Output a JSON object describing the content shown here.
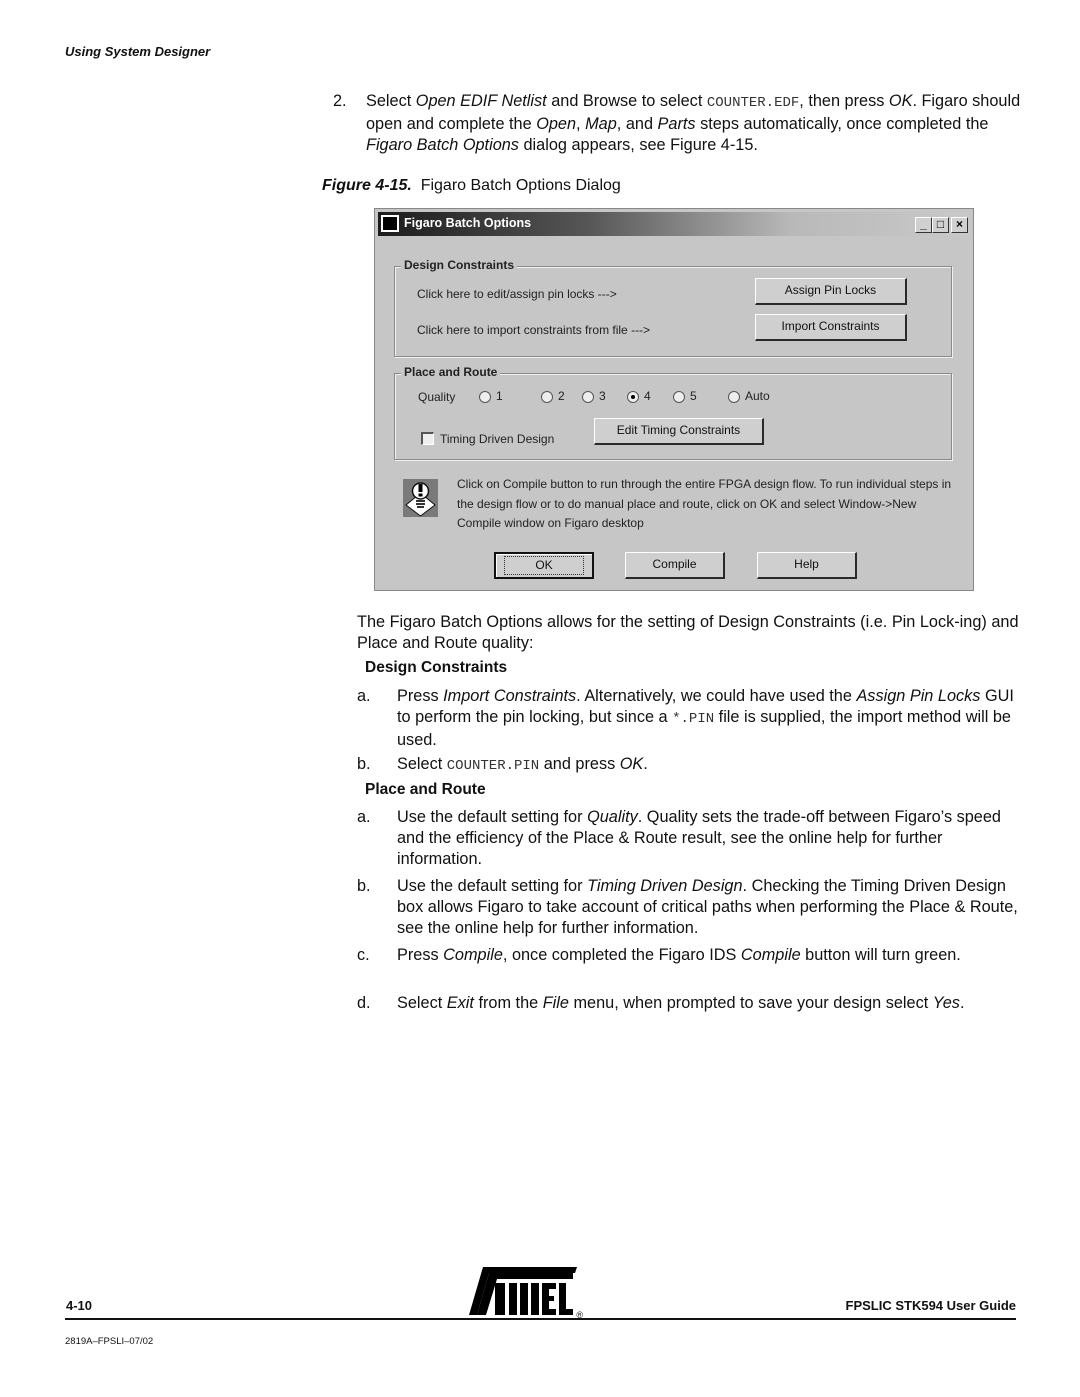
{
  "running_head": "Using System Designer",
  "step2": {
    "number": "2.",
    "t1": "Select ",
    "i1": "Open EDIF Netlist",
    "t2": " and Browse to select ",
    "code1": "COUNTER.EDF",
    "t3": ", then press ",
    "i2": "OK",
    "t4": ". Figaro should open and complete the ",
    "i3": "Open",
    "t5": ", ",
    "i4": "Map",
    "t6": ", and ",
    "i5": "Parts",
    "t7": " steps automatically, once completed the ",
    "i6": "Figaro Batch Options",
    "t8": " dialog appears, see Figure 4-15."
  },
  "figure_caption": {
    "label": "Figure 4-15.",
    "text": "Figaro Batch Options Dialog"
  },
  "dialog": {
    "title": "Figaro Batch Options",
    "window_buttons": {
      "minimize": "_",
      "maximize": "□",
      "close": "×"
    },
    "design_constraints": {
      "title": "Design Constraints",
      "assign_label": "Click here to edit/assign pin locks --->",
      "assign_button": "Assign Pin Locks",
      "import_label": "Click here to import constraints from file --->",
      "import_button": "Import Constraints"
    },
    "place_and_route": {
      "title": "Place and Route",
      "quality_label": "Quality",
      "quality_options": [
        "1",
        "2",
        "3",
        "4",
        "5",
        "Auto"
      ],
      "quality_selected": "4",
      "timing_driven_label": "Timing Driven Design",
      "timing_driven_checked": false,
      "edit_timing_button": "Edit Timing Constraints"
    },
    "info_text": "Click on Compile button to run through the entire FPGA design flow. To run individual steps in the design flow or to do manual place and route, click on OK and select Window->New Compile window on Figaro desktop",
    "buttons": {
      "ok": "OK",
      "compile": "Compile",
      "help": "Help"
    }
  },
  "intro": "The Figaro Batch Options allows for the setting of Design Constraints (i.e. Pin Lock-ing) and Place and Route quality:",
  "design_constraints_section": {
    "heading": "Design Constraints",
    "a": {
      "marker": "a.",
      "t1": "Press ",
      "i1": "Import Constraints",
      "t2": ". Alternatively, we could have used the ",
      "i2": "Assign Pin Locks",
      "t3": " GUI to perform the pin locking, but since a ",
      "code": "*.PIN",
      "t4": " file is supplied, the import method will be used."
    },
    "b": {
      "marker": "b.",
      "t1": "Select ",
      "code": "COUNTER.PIN",
      "t2": " and press ",
      "i1": "OK",
      "t3": "."
    }
  },
  "place_route_section": {
    "heading": "Place and Route",
    "a": {
      "marker": "a.",
      "t1": "Use the default setting for ",
      "i1": "Quality",
      "t2": ". Quality sets the trade-off between Figaro’s speed and the efficiency of the Place & Route result, see the online help for further information."
    },
    "b": {
      "marker": "b.",
      "t1": "Use the default setting for ",
      "i1": "Timing Driven Design",
      "t2": ". Checking the Timing Driven Design box allows Figaro to take account of critical paths when performing the Place & Route, see the online help for further information."
    },
    "c": {
      "marker": "c.",
      "t1": "Press ",
      "i1": "Compile",
      "t2": ", once completed the Figaro IDS ",
      "i2": "Compile",
      "t3": " button will turn green."
    },
    "d": {
      "marker": "d.",
      "t1": "Select ",
      "i1": "Exit",
      "t2": " from the ",
      "i2": "File",
      "t3": " menu, when prompted to save your design select ",
      "i3": "Yes",
      "t4": "."
    }
  },
  "footer": {
    "page_number": "4-10",
    "logo": "ATMEL",
    "logo_mark": "®",
    "guide_title": "FPSLIC STK594 User Guide",
    "doc_code": "2819A–FPSLI–07/02"
  }
}
